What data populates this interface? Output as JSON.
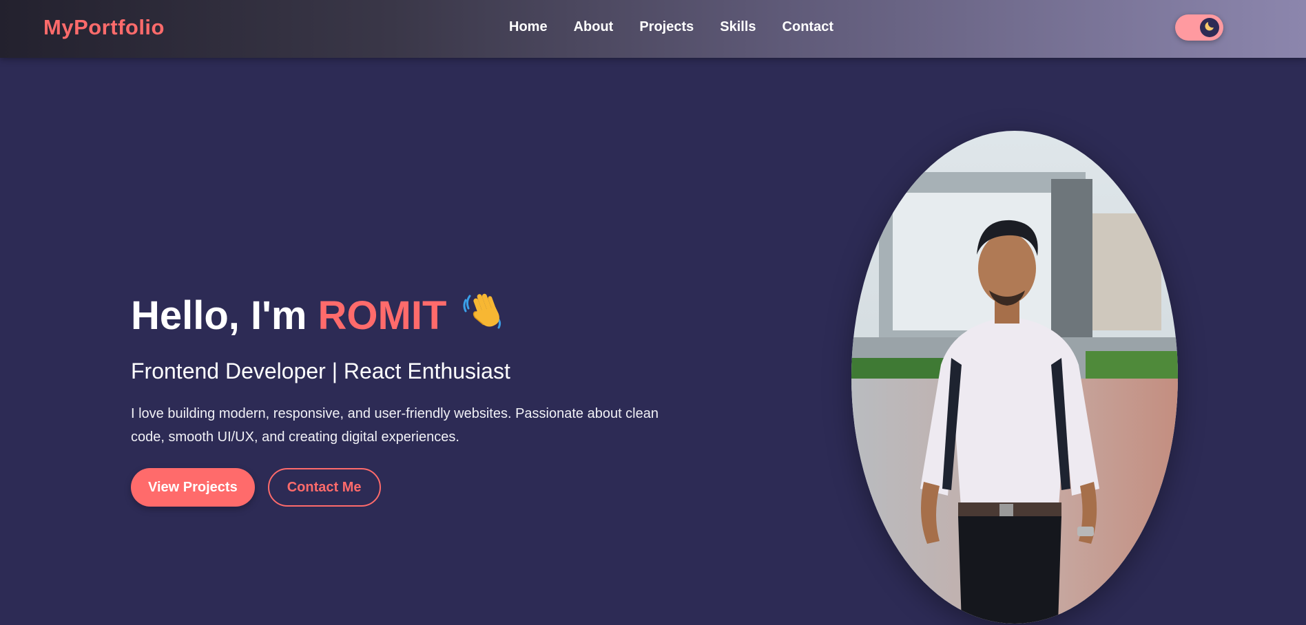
{
  "header": {
    "logo": "MyPortfolio",
    "nav": [
      "Home",
      "About",
      "Projects",
      "Skills",
      "Contact"
    ],
    "theme_toggle_icon": "moon-icon"
  },
  "hero": {
    "greeting": "Hello, I'm",
    "name": "ROMIT",
    "wave_icon": "waving-hand-icon",
    "subtitle": "Frontend Developer | React Enthusiast",
    "description": "I love building modern, responsive, and user-friendly websites. Passionate about clean code, smooth UI/UX, and creating digital experiences.",
    "primary_button": "View Projects",
    "secondary_button": "Contact Me"
  },
  "colors": {
    "accent": "#ff6b6b",
    "background": "#2d2b55",
    "text": "#ffffff"
  }
}
